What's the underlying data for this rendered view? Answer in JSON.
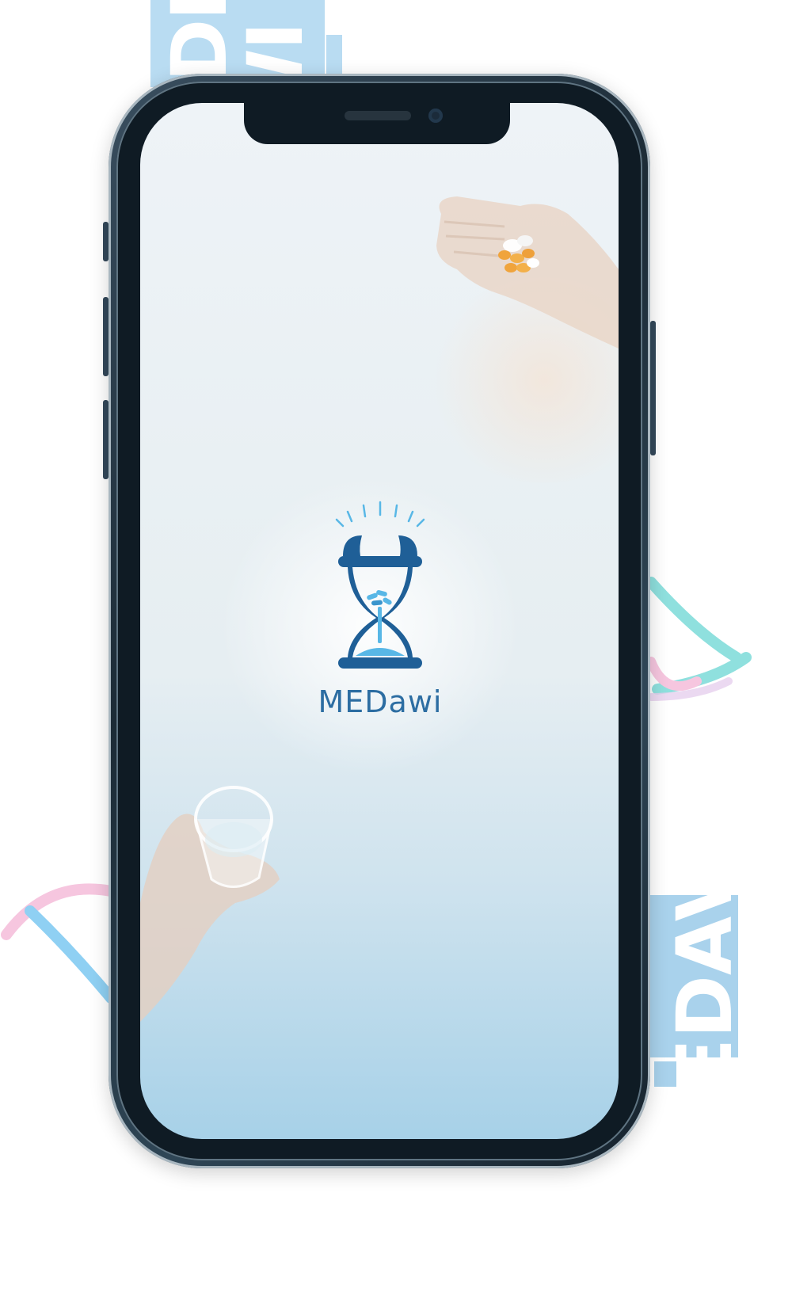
{
  "app": {
    "name": "MEDawi"
  },
  "decorations": {
    "top_block_text": "EDI WI",
    "bottom_block_text": "EDAV"
  },
  "colors": {
    "brand_blue": "#2c6da2",
    "logo_blue": "#1f5f97",
    "logo_light_blue": "#58b7e6",
    "deco_block": "#b9dcf2",
    "deco_teal": "#8fe0de",
    "deco_pink": "#f6c6df",
    "deco_sky": "#8fd0f3"
  },
  "icons": {
    "logo": "hourglass-alarm-pill-icon",
    "top_right_image": "hand-holding-pills",
    "bottom_left_image": "hand-holding-glass-of-water"
  }
}
